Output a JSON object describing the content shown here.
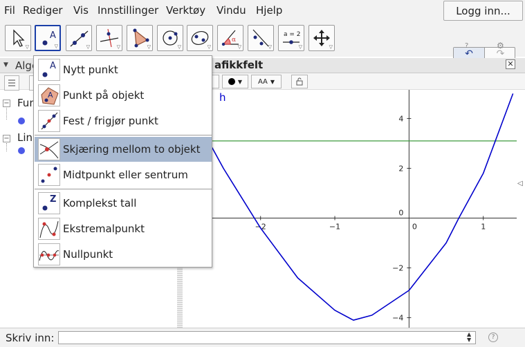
{
  "menubar": {
    "items": [
      "Fil",
      "Rediger",
      "Vis",
      "Innstillinger",
      "Verktøy",
      "Vindu",
      "Hjelp"
    ],
    "login_label": "Logg inn..."
  },
  "toolbar": {
    "tools": [
      "move-tool",
      "point-tool",
      "line-tool",
      "perpendicular-line-tool",
      "polygon-tool",
      "circle-tool",
      "ellipse-tool",
      "angle-tool",
      "reflect-tool",
      "slider-tool",
      "move-graphics-view-tool"
    ],
    "slider_icon_text": "a = 2",
    "undo_icon": "↶",
    "redo_icon": "↷",
    "help_icon_text": "?",
    "settings_icon": "⚙"
  },
  "algebra": {
    "title": "Alge",
    "groups": [
      {
        "label": "Fun",
        "toggle": "−"
      },
      {
        "label": "Lin",
        "toggle": "−"
      }
    ]
  },
  "graphics": {
    "title": "afikkfelt",
    "close_icon": "✕",
    "curve_label": "h",
    "style_bar": {
      "text_size_label": "AA"
    }
  },
  "dropdown": {
    "groups": [
      [
        "Nytt punkt",
        "Punkt på objekt",
        "Fest / frigjør punkt"
      ],
      [
        "Skjæring mellom to objekt",
        "Midtpunkt eller sentrum"
      ],
      [
        "Komplekst tall",
        "Ekstremalpunkt",
        "Nullpunkt"
      ]
    ],
    "highlighted": "Skjæring mellom to objekt",
    "icon_letters": {
      "new_point": "A",
      "point_on_object": "A",
      "complex": "Z"
    }
  },
  "inputbar": {
    "label": "Skriv inn:",
    "value": "",
    "help": "?"
  },
  "chart_data": {
    "type": "line",
    "series": [
      {
        "name": "h",
        "expression": "quadratic",
        "points": [
          [
            -3.05,
            5.0
          ],
          [
            -2.5,
            2.0
          ],
          [
            -2.0,
            -0.4
          ],
          [
            -1.5,
            -2.4
          ],
          [
            -1.0,
            -3.7
          ],
          [
            -0.75,
            -4.1
          ],
          [
            -0.5,
            -3.9
          ],
          [
            0.0,
            -2.9
          ],
          [
            0.5,
            -1.0
          ],
          [
            0.67,
            0.0
          ],
          [
            1.0,
            1.8
          ],
          [
            1.4,
            5.0
          ]
        ],
        "color": "#0000cc"
      },
      {
        "name": "",
        "expression": "horizontal line",
        "y": 3.1,
        "color": "#3c9a3c"
      }
    ],
    "x_ticks": [
      "−2",
      "−1",
      "0",
      "1"
    ],
    "y_ticks": [
      "4",
      "2",
      "0",
      "−2",
      "−4"
    ],
    "xlim": [
      -3.05,
      1.45
    ],
    "ylim": [
      -4.4,
      5.15
    ],
    "grid": false
  }
}
